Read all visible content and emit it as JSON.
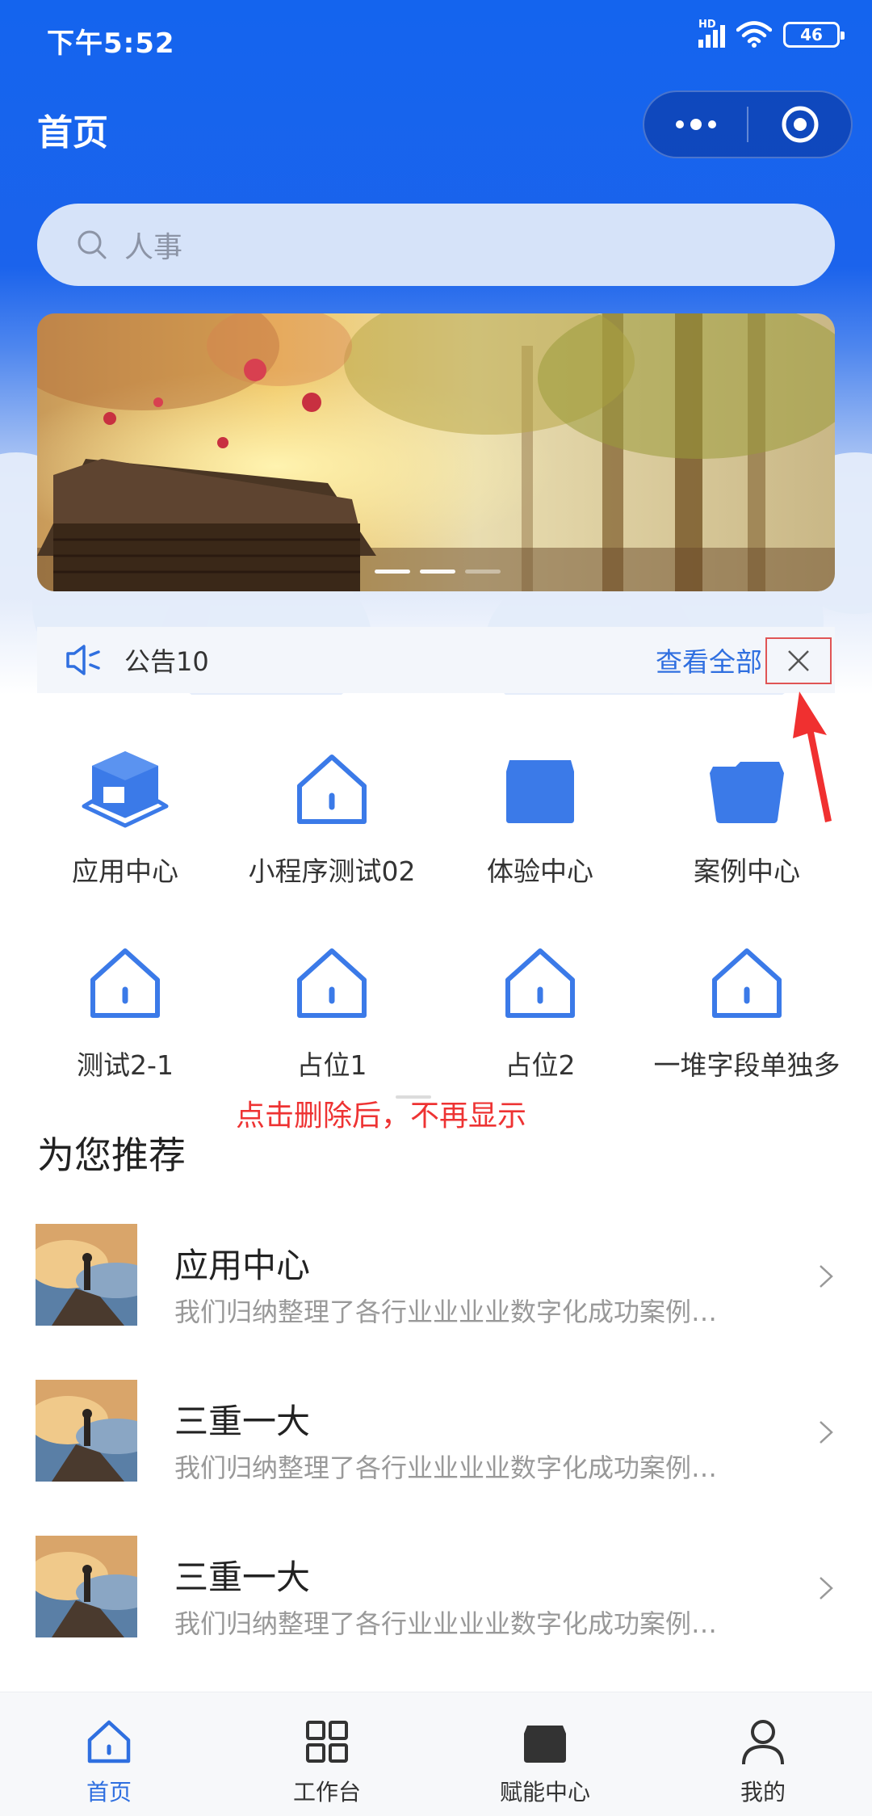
{
  "status_bar": {
    "time": "下午5:52",
    "network": "HD",
    "battery": "46"
  },
  "nav": {
    "title": "首页"
  },
  "search": {
    "placeholder": "人事"
  },
  "banner": {
    "slide_count": 3,
    "active_index": 1
  },
  "notice": {
    "text": "公告10",
    "view_all": "查看全部"
  },
  "grid": {
    "items": [
      {
        "label": "应用中心",
        "icon": "cube-icon"
      },
      {
        "label": "小程序测试02",
        "icon": "home-icon"
      },
      {
        "label": "体验中心",
        "icon": "block-icon"
      },
      {
        "label": "案例中心",
        "icon": "folder-icon"
      },
      {
        "label": "测试2-1",
        "icon": "home-icon"
      },
      {
        "label": "占位1",
        "icon": "home-icon"
      },
      {
        "label": "占位2",
        "icon": "home-icon"
      },
      {
        "label": "一堆字段单独多",
        "icon": "home-icon"
      }
    ]
  },
  "annotation": {
    "text": "点击删除后，不再显示"
  },
  "recommend": {
    "title": "为您推荐",
    "items": [
      {
        "title": "应用中心",
        "desc": "我们归纳整理了各行业业业业数字化成功案例…"
      },
      {
        "title": "三重一大",
        "desc": "我们归纳整理了各行业业业业数字化成功案例…"
      },
      {
        "title": "三重一大",
        "desc": "我们归纳整理了各行业业业业数字化成功案例…"
      }
    ]
  },
  "tabbar": {
    "items": [
      {
        "label": "首页",
        "icon": "home-icon",
        "active": true
      },
      {
        "label": "工作台",
        "icon": "grid-icon",
        "active": false
      },
      {
        "label": "赋能中心",
        "icon": "box-icon",
        "active": false
      },
      {
        "label": "我的",
        "icon": "user-icon",
        "active": false
      }
    ]
  },
  "colors": {
    "primary": "#1b63ec",
    "accent_blue": "#2f6fe0",
    "icon_blue": "#3b7ae8",
    "annotation_red": "#ee3333"
  }
}
